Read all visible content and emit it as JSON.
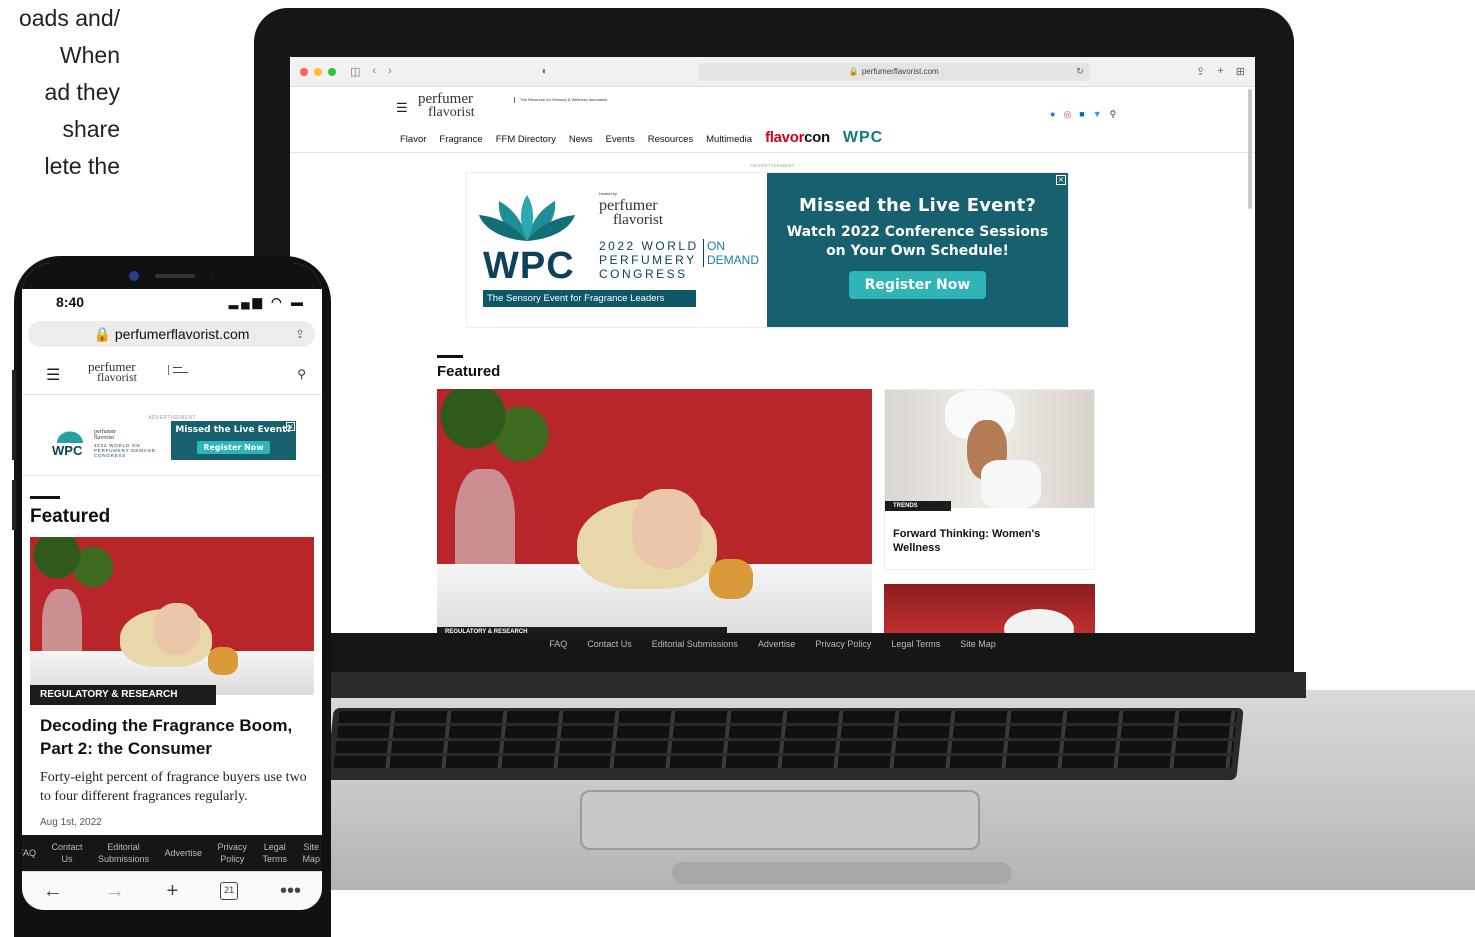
{
  "background_text": [
    "oads and/",
    "When",
    "ad they",
    "share",
    "lete the"
  ],
  "laptop": {
    "browser": {
      "url": "perfumerflavorist.com"
    },
    "site": {
      "logo": {
        "line1": "perfumer",
        "line2": "flavorist",
        "tagline": "The Resource for Sensory & Wellness Innovation"
      },
      "nav": [
        "Flavor",
        "Fragrance",
        "FFM Directory",
        "News",
        "Events",
        "Resources",
        "Multimedia"
      ],
      "nav_flavorcon": {
        "a": "flavor",
        "b": "con"
      },
      "nav_wpc": "WPC",
      "social_icons": [
        "facebook-icon",
        "instagram-icon",
        "linkedin-icon",
        "twitter-icon",
        "search-icon"
      ]
    },
    "ad": {
      "label": "ADVERTISEMENT",
      "wpc": "WPC",
      "hosted_by": "Hosted by",
      "logo_line1": "perfumer",
      "logo_line2": "flavorist",
      "congress_line1": "2022 WORLD",
      "congress_line2": "PERFUMERY",
      "congress_line3": "CONGRESS",
      "on": "ON",
      "demand": "DEMAND",
      "tagline": "The Sensory Event for Fragrance Leaders",
      "headline": "Missed the Live Event?",
      "subhead1": "Watch 2022 Conference Sessions",
      "subhead2": "on Your Own Schedule!",
      "cta": "Register Now",
      "close": "×"
    },
    "featured": {
      "heading": "Featured",
      "hero_category": "REGULATORY & RESEARCH",
      "side1_category": "TRENDS",
      "side1_title": "Forward Thinking: Women's Wellness"
    },
    "footer": [
      "FAQ",
      "Contact Us",
      "Editorial Submissions",
      "Advertise",
      "Privacy Policy",
      "Legal Terms",
      "Site Map"
    ]
  },
  "phone": {
    "time": "8:40",
    "url": "perfumerflavorist.com",
    "logo": {
      "line1": "perfumer",
      "line2": "flavorist"
    },
    "ad": {
      "label": "ADVERTISEMENT",
      "wpc": "WPC",
      "logo_line1": "perfumer",
      "logo_line2": "flavorist",
      "congress": "2022 WORLD ON PERFUMERY DEMAND CONGRESS",
      "headline": "Missed the Live Event?",
      "cta": "Register Now",
      "close": "×"
    },
    "featured": {
      "heading": "Featured",
      "category": "REGULATORY & RESEARCH",
      "title": "Decoding the Fragrance Boom, Part 2: the Consumer",
      "desc": "Forty-eight percent of fragrance buyers use two to four different fragrances regularly.",
      "date": "Aug 1st, 2022"
    },
    "footer": [
      {
        "l1": "FAQ",
        "l2": ""
      },
      {
        "l1": "Contact",
        "l2": "Us"
      },
      {
        "l1": "Editorial",
        "l2": "Submissions"
      },
      {
        "l1": "Advertise",
        "l2": ""
      },
      {
        "l1": "Privacy",
        "l2": "Policy"
      },
      {
        "l1": "Legal",
        "l2": "Terms"
      },
      {
        "l1": "Site",
        "l2": "Map"
      }
    ],
    "tab_count": "21"
  }
}
